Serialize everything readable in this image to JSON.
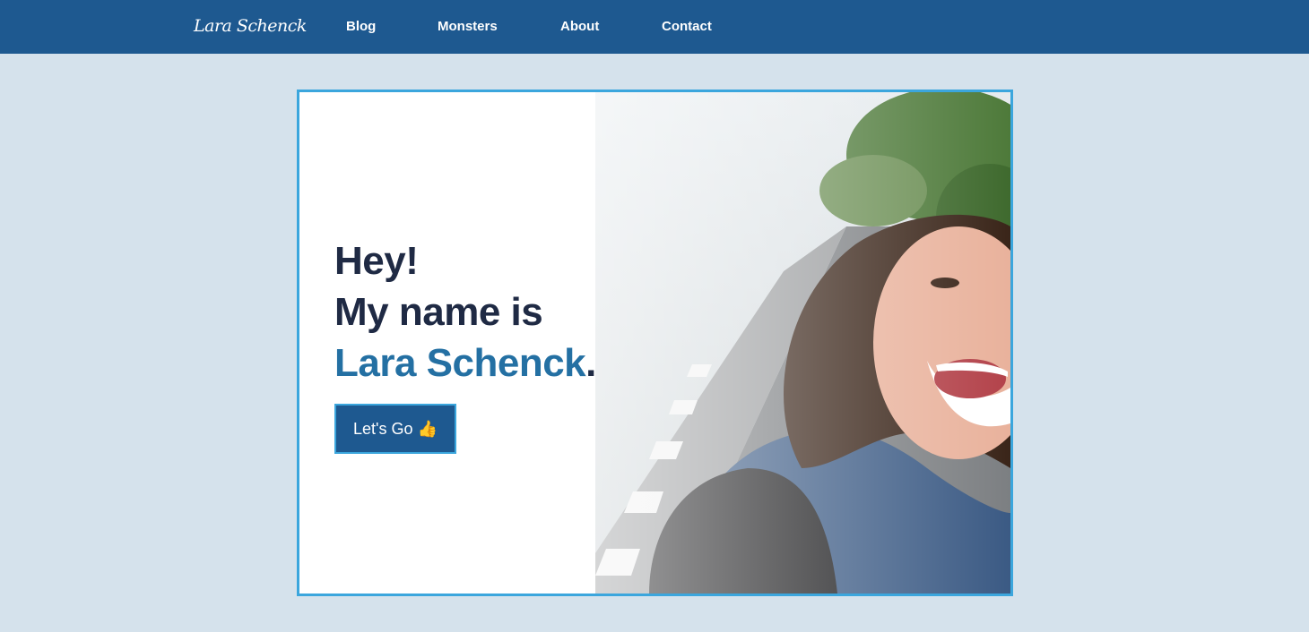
{
  "nav": {
    "logo_text": "Lara Schenck",
    "links": [
      {
        "label": "Blog"
      },
      {
        "label": "Monsters"
      },
      {
        "label": "About"
      },
      {
        "label": "Contact"
      }
    ]
  },
  "hero": {
    "line1": "Hey!",
    "line2": "My name is",
    "name": "Lara Schenck",
    "period": ".",
    "cta_label": "Let's Go",
    "cta_emoji": "👍"
  },
  "colors": {
    "nav_bg": "#1e5990",
    "page_bg": "#d5e2ec",
    "hero_border": "#3ba6dd",
    "heading": "#1f2a44",
    "name_accent": "#2470a3"
  },
  "icons": {
    "logo": "signature-logo",
    "photo": "selfie-photo"
  }
}
